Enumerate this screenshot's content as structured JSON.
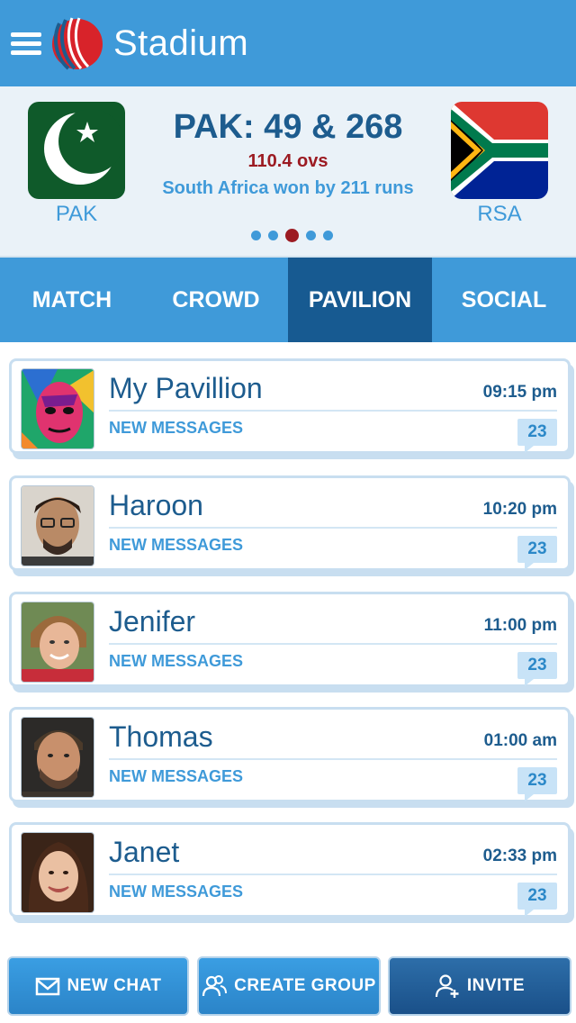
{
  "app": {
    "title": "Stadium",
    "accent": "#3f9ad9",
    "accent_dark": "#175a91",
    "score_red": "#9c1b22"
  },
  "header": {
    "menu_icon": "hamburger-menu-icon",
    "logo_icon": "cricket-ball-logo-icon"
  },
  "match": {
    "home_code": "PAK",
    "away_code": "RSA",
    "score": "PAK: 49 & 268",
    "overs": "110.4 ovs",
    "result": "South Africa won by 211 runs",
    "pager": {
      "count": 5,
      "active_index": 2
    }
  },
  "tabs": [
    {
      "label": "MATCH",
      "active": false
    },
    {
      "label": "CROWD",
      "active": false
    },
    {
      "label": "PAVILION",
      "active": true
    },
    {
      "label": "SOCIAL",
      "active": false
    }
  ],
  "chats": [
    {
      "name": "My Pavillion",
      "time": "09:15 pm",
      "subtitle": "NEW MESSAGES",
      "count": "23"
    },
    {
      "name": "Haroon",
      "time": "10:20 pm",
      "subtitle": "NEW MESSAGES",
      "count": "23"
    },
    {
      "name": "Jenifer",
      "time": "11:00 pm",
      "subtitle": "NEW MESSAGES",
      "count": "23"
    },
    {
      "name": "Thomas",
      "time": "01:00 am",
      "subtitle": "NEW MESSAGES",
      "count": "23"
    },
    {
      "name": "Janet",
      "time": "02:33 pm",
      "subtitle": "NEW MESSAGES",
      "count": "23"
    }
  ],
  "actions": {
    "new_chat": "NEW CHAT",
    "create_group": "CREATE GROUP",
    "invite": "INVITE"
  }
}
